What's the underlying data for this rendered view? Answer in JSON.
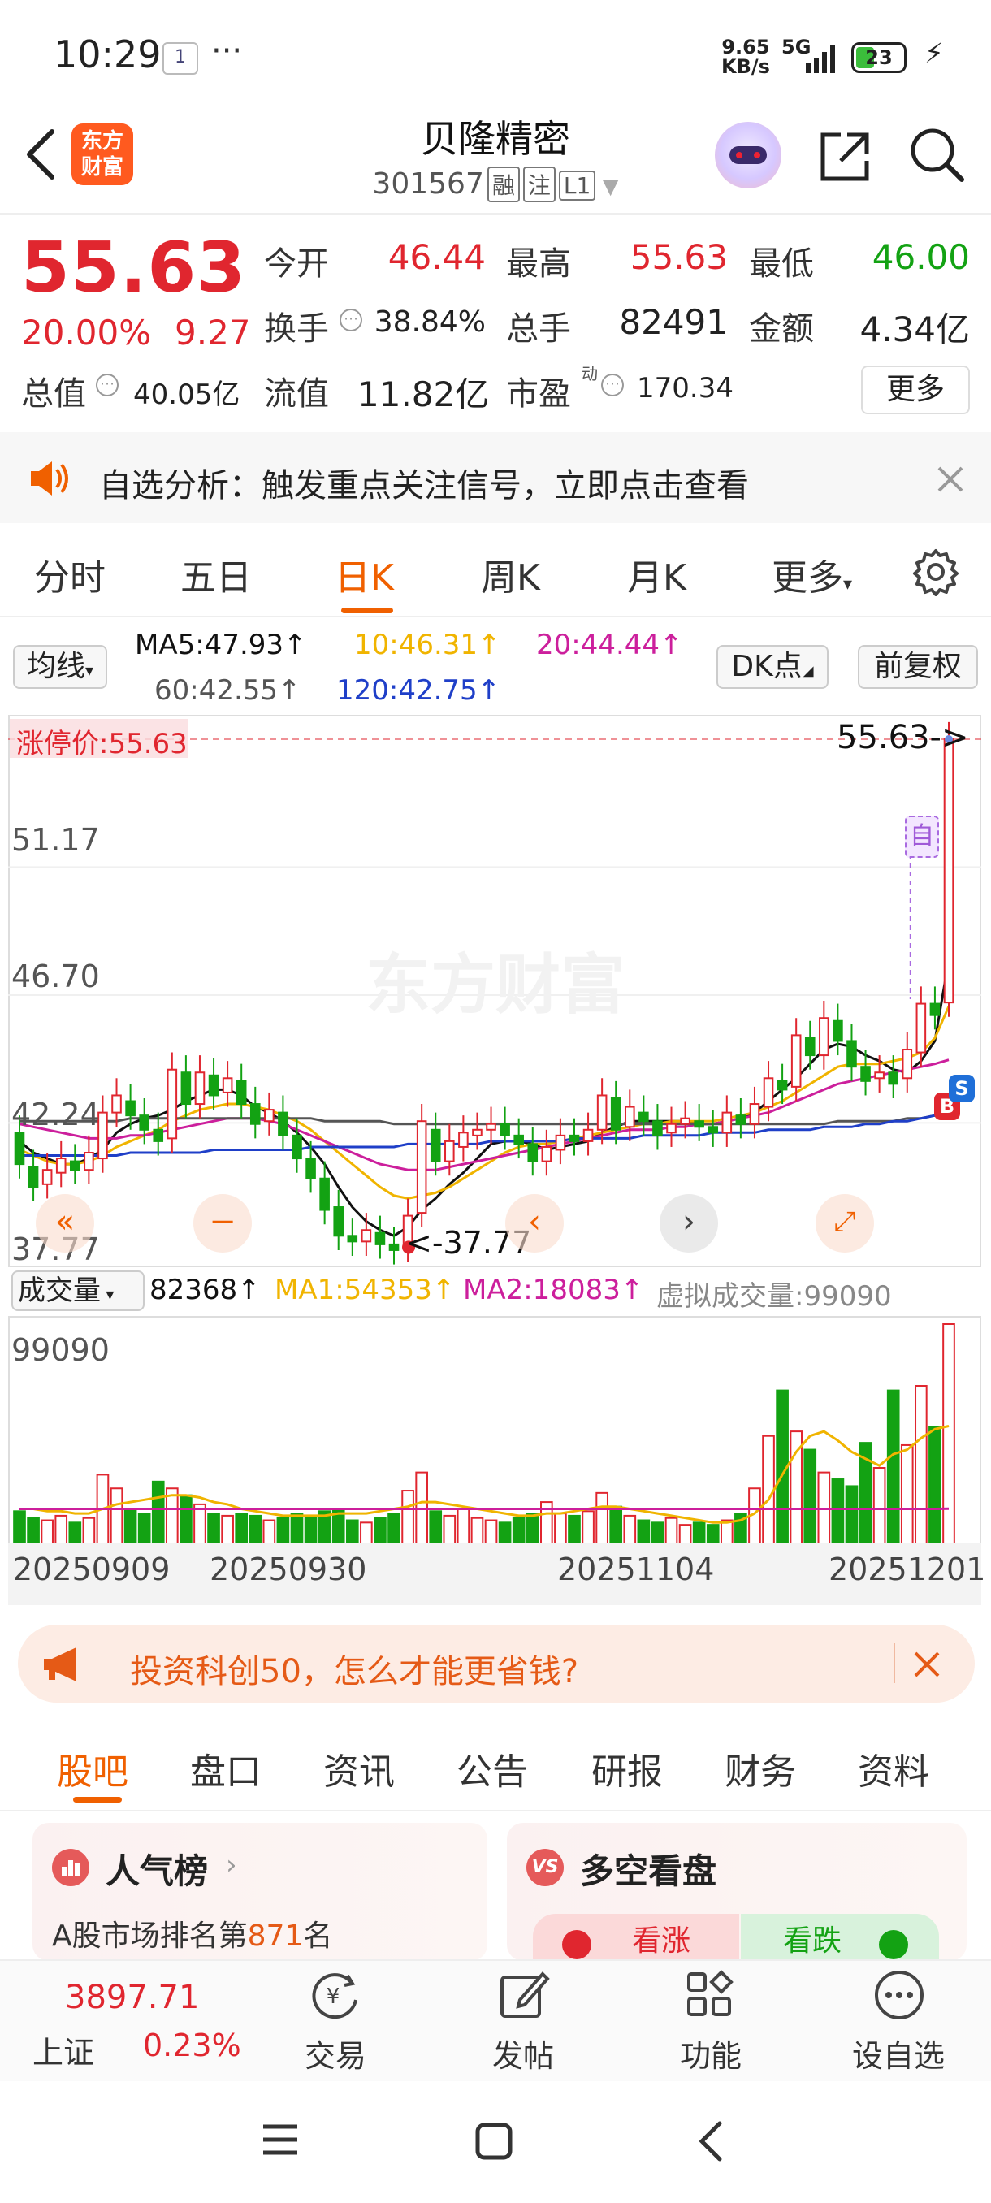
{
  "status_bar": {
    "time": "10:29",
    "notif_badge": "1",
    "more_dots": "···",
    "net_speed_top": "9.65",
    "net_speed_unit": "KB/s",
    "network": "5G",
    "battery": "23"
  },
  "header": {
    "stock_name": "贝隆精密",
    "stock_code": "301567",
    "tags": [
      "融",
      "注",
      "L1"
    ],
    "logo_line1": "东方",
    "logo_line2": "财富"
  },
  "quote": {
    "price": "55.63",
    "change_pct": "20.00%",
    "change": "9.27",
    "open_label": "今开",
    "open": "46.44",
    "high_label": "最高",
    "high": "55.63",
    "low_label": "最低",
    "low": "46.00",
    "turnover_label": "换手",
    "turnover": "38.84%",
    "volume_label": "总手",
    "volume": "82491",
    "amount_label": "金额",
    "amount": "4.34亿",
    "mktcap_label": "总值",
    "mktcap": "40.05亿",
    "float_label": "流值",
    "float": "11.82亿",
    "pe_label": "市盈",
    "pe_sup": "动",
    "pe": "170.34",
    "more_label": "更多"
  },
  "notice": {
    "text": "自选分析：触发重点关注信号，立即点击查看"
  },
  "period_tabs": [
    "分时",
    "五日",
    "日K",
    "周K",
    "月K",
    "更多"
  ],
  "period_active": "日K",
  "ma_bar": {
    "select_label": "均线",
    "ma5": "MA5:47.93↑",
    "ma10": "10:46.31↑",
    "ma20": "20:44.44↑",
    "ma60": "60:42.55↑",
    "ma120": "120:42.75↑",
    "dk_label": "DK点",
    "fq_label": "前复权"
  },
  "colors": {
    "up": "#e0262f",
    "down": "#13a213",
    "ma5": "#111111",
    "ma10": "#f0b400",
    "ma20": "#cc1f9c",
    "ma60": "#555555",
    "ma120": "#1f3fc8",
    "accent": "#f06000"
  },
  "chart_data": {
    "type": "candlestick",
    "y_axis_labels": [
      "51.17",
      "46.70",
      "42.24",
      "37.77"
    ],
    "limit_up_label": "涨停价:55.63",
    "last_price_marker": "55.63->",
    "low_marker": "<-37.77",
    "self_select_marker": "自",
    "watermark": "东方财富",
    "ylim": [
      37.77,
      55.63
    ],
    "candles": [
      {
        "o": 41.9,
        "c": 40.8
      },
      {
        "o": 40.7,
        "c": 40.0
      },
      {
        "o": 40.1,
        "c": 40.6
      },
      {
        "o": 40.5,
        "c": 41.0
      },
      {
        "o": 40.9,
        "c": 40.6
      },
      {
        "o": 40.6,
        "c": 41.2
      },
      {
        "o": 41.0,
        "c": 42.6
      },
      {
        "o": 42.6,
        "c": 43.2
      },
      {
        "o": 43.0,
        "c": 42.5
      },
      {
        "o": 42.5,
        "c": 42.0
      },
      {
        "o": 42.0,
        "c": 41.6
      },
      {
        "o": 41.7,
        "c": 44.1
      },
      {
        "o": 44.0,
        "c": 42.9
      },
      {
        "o": 42.9,
        "c": 44.0
      },
      {
        "o": 43.9,
        "c": 43.2
      },
      {
        "o": 43.3,
        "c": 43.8
      },
      {
        "o": 43.7,
        "c": 42.9
      },
      {
        "o": 42.9,
        "c": 42.2
      },
      {
        "o": 42.3,
        "c": 42.7
      },
      {
        "o": 42.6,
        "c": 41.8
      },
      {
        "o": 41.8,
        "c": 41.0
      },
      {
        "o": 41.0,
        "c": 40.3
      },
      {
        "o": 40.3,
        "c": 39.2
      },
      {
        "o": 39.3,
        "c": 38.3
      },
      {
        "o": 38.3,
        "c": 38.1
      },
      {
        "o": 38.1,
        "c": 38.5
      },
      {
        "o": 38.4,
        "c": 38.0
      },
      {
        "o": 38.0,
        "c": 37.8
      },
      {
        "o": 37.9,
        "c": 39.0
      },
      {
        "o": 39.1,
        "c": 42.3
      },
      {
        "o": 42.0,
        "c": 40.9
      },
      {
        "o": 40.9,
        "c": 41.6
      },
      {
        "o": 41.4,
        "c": 41.9
      },
      {
        "o": 41.8,
        "c": 42.0
      },
      {
        "o": 42.0,
        "c": 42.2
      },
      {
        "o": 42.2,
        "c": 41.8
      },
      {
        "o": 41.8,
        "c": 41.5
      },
      {
        "o": 41.5,
        "c": 40.9
      },
      {
        "o": 40.9,
        "c": 41.4
      },
      {
        "o": 41.3,
        "c": 41.8
      },
      {
        "o": 41.8,
        "c": 41.6
      },
      {
        "o": 41.6,
        "c": 42.0
      },
      {
        "o": 42.0,
        "c": 43.2
      },
      {
        "o": 43.1,
        "c": 42.0
      },
      {
        "o": 42.1,
        "c": 42.8
      },
      {
        "o": 42.6,
        "c": 42.3
      },
      {
        "o": 42.3,
        "c": 41.8
      },
      {
        "o": 41.9,
        "c": 42.2
      },
      {
        "o": 42.2,
        "c": 42.4
      },
      {
        "o": 42.3,
        "c": 42.1
      },
      {
        "o": 42.1,
        "c": 41.9
      },
      {
        "o": 41.9,
        "c": 42.6
      },
      {
        "o": 42.5,
        "c": 42.2
      },
      {
        "o": 42.2,
        "c": 42.9
      },
      {
        "o": 42.8,
        "c": 43.8
      },
      {
        "o": 43.7,
        "c": 43.4
      },
      {
        "o": 43.5,
        "c": 45.3
      },
      {
        "o": 45.2,
        "c": 44.6
      },
      {
        "o": 44.6,
        "c": 45.9
      },
      {
        "o": 45.8,
        "c": 45.1
      },
      {
        "o": 45.1,
        "c": 44.2
      },
      {
        "o": 44.2,
        "c": 43.7
      },
      {
        "o": 43.8,
        "c": 44.0
      },
      {
        "o": 44.0,
        "c": 43.6
      },
      {
        "o": 43.8,
        "c": 44.8
      },
      {
        "o": 44.7,
        "c": 46.4
      },
      {
        "o": 46.4,
        "c": 46.0
      },
      {
        "o": 46.44,
        "c": 55.63
      }
    ],
    "ma_series": [
      {
        "name": "MA5",
        "values": [
          41.6,
          41.2,
          41.0,
          40.8,
          40.8,
          41.0,
          41.3,
          41.9,
          42.2,
          42.4,
          42.5,
          42.7,
          43.0,
          43.2,
          43.4,
          43.4,
          43.2,
          42.8,
          42.6,
          42.3,
          41.9,
          41.4,
          40.8,
          40.0,
          39.3,
          38.8,
          38.5,
          38.3,
          38.6,
          39.2,
          39.6,
          40.1,
          40.5,
          41.0,
          41.5,
          41.6,
          41.6,
          41.5,
          41.3,
          41.4,
          41.5,
          41.6,
          41.9,
          42.1,
          42.3,
          42.3,
          42.3,
          42.3,
          42.3,
          42.2,
          42.2,
          42.3,
          42.4,
          42.6,
          43.0,
          43.4,
          43.8,
          44.3,
          44.8,
          45.0,
          44.9,
          44.6,
          44.4,
          44.1,
          44.0,
          44.4,
          45.1,
          47.93
        ]
      },
      {
        "name": "MA10",
        "values": [
          41.3,
          41.1,
          40.9,
          40.8,
          40.8,
          40.9,
          41.1,
          41.4,
          41.6,
          41.8,
          42.0,
          42.3,
          42.5,
          42.7,
          42.8,
          42.9,
          42.9,
          42.8,
          42.7,
          42.5,
          42.3,
          42.0,
          41.6,
          41.2,
          40.8,
          40.4,
          40.0,
          39.7,
          39.6,
          39.7,
          39.8,
          40.0,
          40.3,
          40.6,
          40.9,
          41.2,
          41.4,
          41.5,
          41.5,
          41.6,
          41.7,
          41.8,
          41.9,
          42.0,
          42.1,
          42.2,
          42.2,
          42.3,
          42.3,
          42.3,
          42.3,
          42.4,
          42.5,
          42.6,
          42.8,
          43.0,
          43.3,
          43.6,
          43.9,
          44.2,
          44.3,
          44.3,
          44.3,
          44.4,
          44.5,
          44.7,
          45.2,
          46.31
        ]
      },
      {
        "name": "MA20",
        "values": [
          42.2,
          42.1,
          42.0,
          41.9,
          41.8,
          41.7,
          41.7,
          41.7,
          41.8,
          41.8,
          41.9,
          42.0,
          42.1,
          42.2,
          42.3,
          42.4,
          42.4,
          42.4,
          42.3,
          42.2,
          42.0,
          41.8,
          41.6,
          41.4,
          41.2,
          41.0,
          40.8,
          40.7,
          40.6,
          40.6,
          40.6,
          40.7,
          40.8,
          40.9,
          41.0,
          41.1,
          41.2,
          41.3,
          41.4,
          41.5,
          41.6,
          41.7,
          41.8,
          41.9,
          42.0,
          42.0,
          42.0,
          42.1,
          42.1,
          42.2,
          42.2,
          42.3,
          42.4,
          42.5,
          42.6,
          42.8,
          43.0,
          43.2,
          43.4,
          43.6,
          43.7,
          43.8,
          43.9,
          44.0,
          44.1,
          44.2,
          44.3,
          44.44
        ]
      },
      {
        "name": "MA60",
        "values": [
          42.3,
          42.3,
          42.3,
          42.3,
          42.3,
          42.3,
          42.3,
          42.3,
          42.4,
          42.4,
          42.4,
          42.4,
          42.4,
          42.4,
          42.4,
          42.4,
          42.4,
          42.4,
          42.4,
          42.4,
          42.4,
          42.4,
          42.3,
          42.3,
          42.3,
          42.3,
          42.3,
          42.2,
          42.2,
          42.2,
          42.2,
          42.2,
          42.2,
          42.2,
          42.2,
          42.2,
          42.2,
          42.2,
          42.2,
          42.2,
          42.2,
          42.2,
          42.2,
          42.2,
          42.2,
          42.2,
          42.2,
          42.2,
          42.2,
          42.2,
          42.2,
          42.2,
          42.2,
          42.2,
          42.2,
          42.2,
          42.2,
          42.2,
          42.2,
          42.3,
          42.3,
          42.3,
          42.3,
          42.3,
          42.4,
          42.4,
          42.5,
          42.55
        ]
      },
      {
        "name": "MA120",
        "values": [
          41.1,
          41.1,
          41.1,
          41.1,
          41.1,
          41.1,
          41.1,
          41.1,
          41.2,
          41.2,
          41.2,
          41.2,
          41.2,
          41.2,
          41.3,
          41.3,
          41.3,
          41.3,
          41.3,
          41.3,
          41.3,
          41.4,
          41.4,
          41.4,
          41.4,
          41.4,
          41.4,
          41.4,
          41.5,
          41.5,
          41.5,
          41.5,
          41.5,
          41.5,
          41.6,
          41.6,
          41.6,
          41.6,
          41.6,
          41.6,
          41.7,
          41.7,
          41.7,
          41.7,
          41.7,
          41.8,
          41.8,
          41.8,
          41.8,
          41.8,
          41.9,
          41.9,
          41.9,
          41.9,
          42.0,
          42.0,
          42.0,
          42.0,
          42.1,
          42.1,
          42.1,
          42.2,
          42.2,
          42.3,
          42.3,
          42.4,
          42.5,
          42.75
        ]
      }
    ]
  },
  "volume_bar": {
    "select_label": "成交量",
    "value": "82368↑",
    "ma1": "MA1:54353↑",
    "ma2": "MA2:18083↑",
    "virtual": "虚拟成交量:99090"
  },
  "volume_data": {
    "max_label": "99090",
    "ylim": [
      0,
      99090
    ],
    "bars": [
      17000,
      14000,
      13000,
      15000,
      12000,
      14000,
      33000,
      27000,
      18000,
      16000,
      30000,
      27000,
      24000,
      20000,
      16000,
      15000,
      16000,
      15000,
      13000,
      14000,
      16000,
      15000,
      17000,
      18000,
      13000,
      12000,
      14000,
      16000,
      26000,
      34000,
      17000,
      15000,
      18000,
      14000,
      13000,
      12000,
      14000,
      16000,
      21000,
      16000,
      15000,
      17000,
      25000,
      19000,
      15000,
      13000,
      12000,
      14000,
      11000,
      12000,
      11000,
      13000,
      16000,
      27000,
      50000,
      70000,
      52000,
      44000,
      34000,
      31000,
      28000,
      47000,
      36000,
      70000,
      46000,
      72000,
      54000,
      99090
    ],
    "ma1": [
      18000,
      18000,
      17000,
      17000,
      16000,
      16000,
      18000,
      20000,
      21000,
      22000,
      23000,
      24000,
      24000,
      23000,
      21000,
      20000,
      18000,
      17000,
      16000,
      15000,
      15000,
      15000,
      15000,
      16000,
      16000,
      16000,
      17000,
      18000,
      19000,
      21000,
      21000,
      20000,
      19000,
      18000,
      17000,
      16000,
      15000,
      15000,
      16000,
      16000,
      17000,
      18000,
      19000,
      19000,
      18000,
      17000,
      16000,
      15000,
      14000,
      13000,
      12000,
      12000,
      13000,
      16000,
      22000,
      33000,
      43000,
      50000,
      52000,
      48000,
      43000,
      40000,
      37000,
      42000,
      44000,
      49000,
      53000,
      54353
    ],
    "ma2": [
      18000,
      18000,
      18000,
      18000,
      18000,
      18000,
      18000,
      18000,
      18000,
      18000,
      18000,
      18000,
      18000,
      18000,
      18000,
      18000,
      18000,
      18000,
      18000,
      18000,
      18000,
      18000,
      18000,
      18000,
      18000,
      18000,
      18000,
      18000,
      18000,
      18000,
      18000,
      18000,
      18000,
      18000,
      18000,
      18000,
      18000,
      18000,
      18000,
      18000,
      18000,
      18000,
      18000,
      18000,
      18000,
      18000,
      18000,
      18000,
      18000,
      18000,
      18000,
      18000,
      18000,
      18000,
      18000,
      18000,
      18000,
      18000,
      18000,
      18000,
      18000,
      18000,
      18000,
      18000,
      18000,
      18000,
      18000,
      18083
    ],
    "dates": [
      "20250909",
      "20250930",
      "20251104",
      "20251201"
    ]
  },
  "ad": {
    "text": "投资科创50，怎么才能更省钱?"
  },
  "bottom_tabs": [
    "股吧",
    "盘口",
    "资讯",
    "公告",
    "研报",
    "财务",
    "资料"
  ],
  "bottom_active": "股吧",
  "cards": {
    "left_title": "人气榜",
    "left_desc_prefix": "A股市场排名第",
    "left_rank": "871",
    "left_desc_suffix": "名",
    "right_title": "多空看盘",
    "right_badge": "VS",
    "bull": "看涨",
    "bear": "看跌"
  },
  "nav": {
    "index_value": "3897.71",
    "index_name": "上证",
    "index_pct": "0.23%",
    "items": [
      "交易",
      "发帖",
      "功能",
      "设自选"
    ]
  }
}
